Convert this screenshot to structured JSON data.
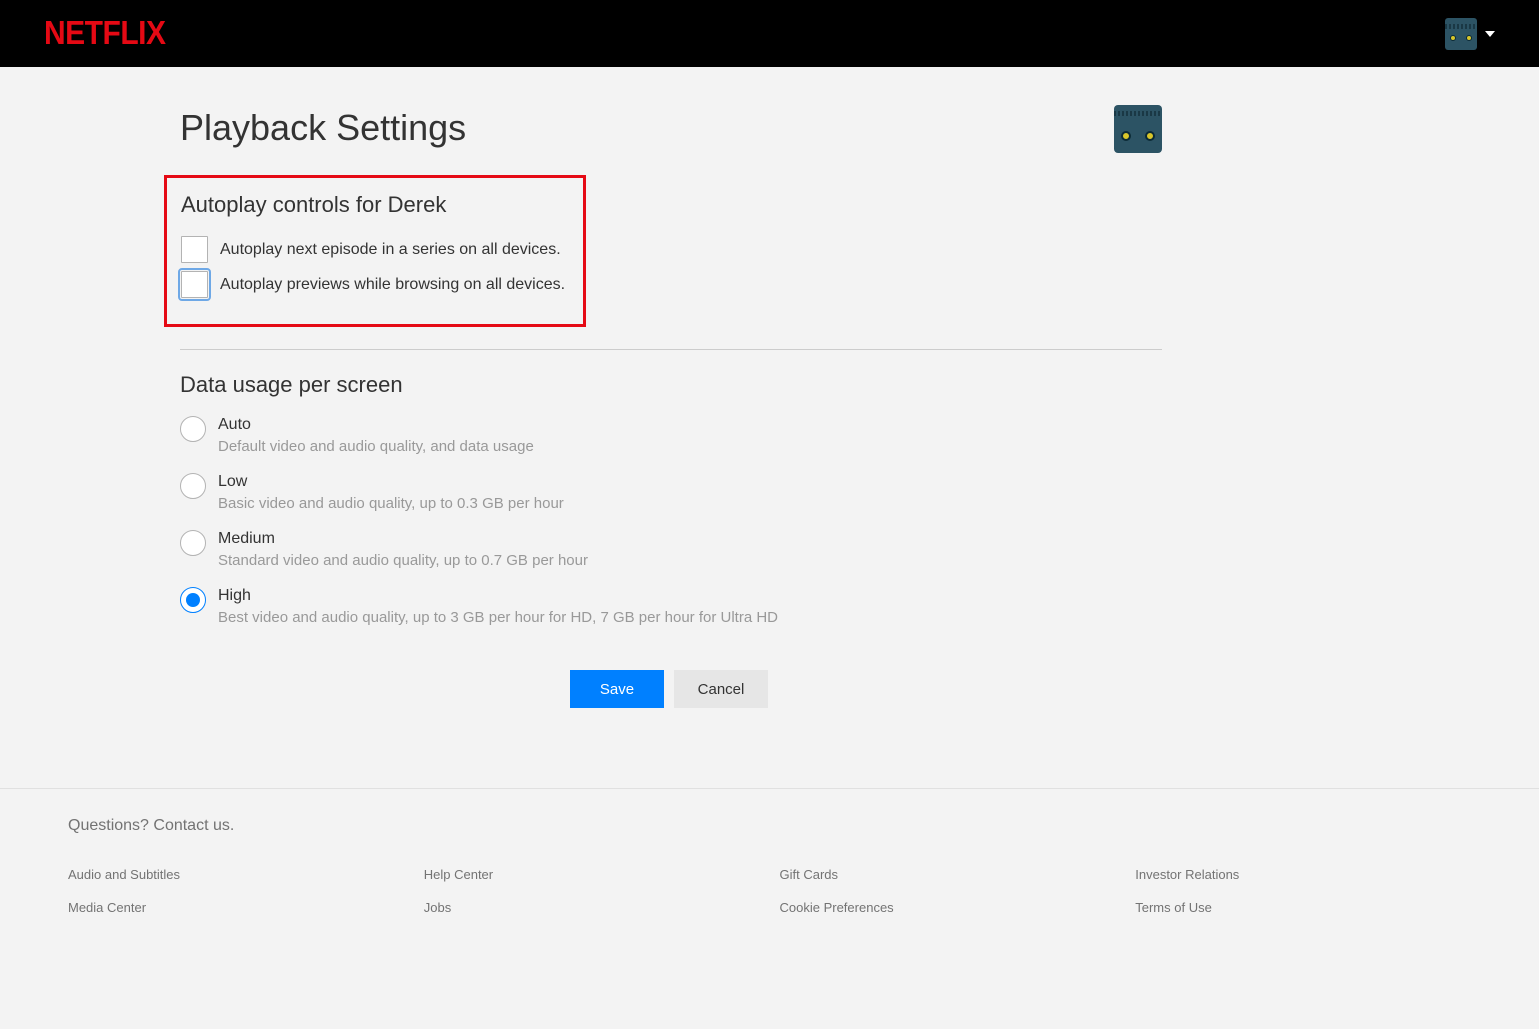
{
  "brand": "NETFLIX",
  "page_title": "Playback Settings",
  "autoplay": {
    "section_title": "Autoplay controls for Derek",
    "options": [
      {
        "label": "Autoplay next episode in a series on all devices.",
        "checked": false,
        "focused": false
      },
      {
        "label": "Autoplay previews while browsing on all devices.",
        "checked": false,
        "focused": true
      }
    ]
  },
  "data_usage": {
    "section_title": "Data usage per screen",
    "selected": "high",
    "options": [
      {
        "id": "auto",
        "label": "Auto",
        "desc": "Default video and audio quality, and data usage"
      },
      {
        "id": "low",
        "label": "Low",
        "desc": "Basic video and audio quality, up to 0.3 GB per hour"
      },
      {
        "id": "medium",
        "label": "Medium",
        "desc": "Standard video and audio quality, up to 0.7 GB per hour"
      },
      {
        "id": "high",
        "label": "High",
        "desc": "Best video and audio quality, up to 3 GB per hour for HD, 7 GB per hour for Ultra HD"
      }
    ]
  },
  "buttons": {
    "save": "Save",
    "cancel": "Cancel"
  },
  "footer": {
    "question": "Questions? Contact us.",
    "links": [
      "Audio and Subtitles",
      "Help Center",
      "Gift Cards",
      "Investor Relations",
      "Media Center",
      "Jobs",
      "Cookie Preferences",
      "Terms of Use"
    ]
  }
}
